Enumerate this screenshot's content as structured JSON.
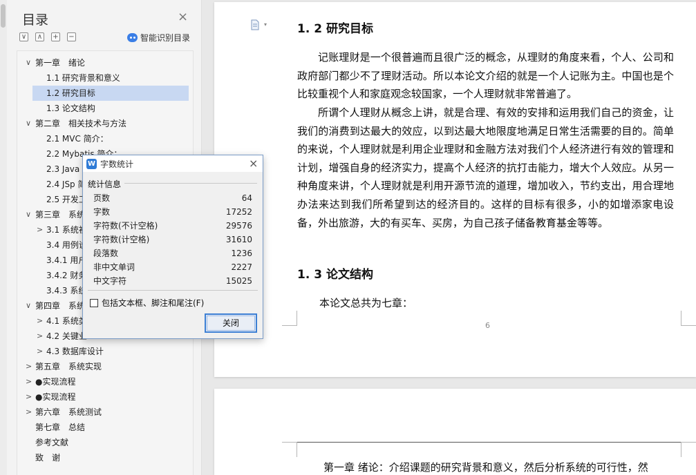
{
  "sidebar": {
    "title": "目录",
    "close_icon": "×",
    "tools": [
      "∨",
      "∧",
      "+",
      "−"
    ],
    "smart_label": "智能识别目录",
    "items": [
      {
        "label": "第一章　绪论",
        "level": 0,
        "arrow": "∨"
      },
      {
        "label": "1.1 研究背景和意义",
        "level": 1,
        "arrow": ""
      },
      {
        "label": "1.2 研究目标",
        "level": 1,
        "arrow": "",
        "selected": true
      },
      {
        "label": "1.3 论文结构",
        "level": 1,
        "arrow": ""
      },
      {
        "label": "第二章　相关技术与方法",
        "level": 0,
        "arrow": "∨"
      },
      {
        "label": "2.1 MVC 简介：",
        "level": 1,
        "arrow": ""
      },
      {
        "label": "2.2 Mybatis 简介：",
        "level": 1,
        "arrow": ""
      },
      {
        "label": "2.3 Java 简",
        "level": 1,
        "arrow": ""
      },
      {
        "label": "2.4 JSp 简",
        "level": 1,
        "arrow": ""
      },
      {
        "label": "2.5 开发工",
        "level": 1,
        "arrow": ""
      },
      {
        "label": "第三章　系统",
        "level": 0,
        "arrow": "∨"
      },
      {
        "label": "3.1 系统初",
        "level": 1,
        "arrow": ">"
      },
      {
        "label": "3.4 用例说",
        "level": 1,
        "arrow": ""
      },
      {
        "label": "3.4.1 用户",
        "level": 1,
        "arrow": ""
      },
      {
        "label": "3.4.2 财务",
        "level": 1,
        "arrow": ""
      },
      {
        "label": "3.4.3 系统",
        "level": 1,
        "arrow": ""
      },
      {
        "label": "第四章　系统",
        "level": 0,
        "arrow": "∨"
      },
      {
        "label": "4.1 系统类",
        "level": 1,
        "arrow": ">"
      },
      {
        "label": "4.2 关键业",
        "level": 1,
        "arrow": ">"
      },
      {
        "label": "4.3 数据库设计",
        "level": 1,
        "arrow": ">"
      },
      {
        "label": "第五章　系统实现",
        "level": 0,
        "arrow": ">"
      },
      {
        "label": "●实现流程",
        "level": 0,
        "arrow": ">"
      },
      {
        "label": "●实现流程",
        "level": 0,
        "arrow": ">"
      },
      {
        "label": "第六章　系统测试",
        "level": 0,
        "arrow": ">"
      },
      {
        "label": "第七章　总结",
        "level": 0,
        "arrow": ""
      },
      {
        "label": "参考文献",
        "level": 0,
        "arrow": ""
      },
      {
        "label": "致　谢",
        "level": 0,
        "arrow": ""
      }
    ]
  },
  "document": {
    "h_1_2": "1. 2 研究目标",
    "p1": "记账理财是一个很普遍而且很广泛的概念，从理财的角度来看，个人、公司和政府部门都少不了理财活动。所以本论文介绍的就是一个人记账为主。中国也是个比较重视个人和家庭观念较国家，一个人理财就非常普遍了。",
    "p2": "所谓个人理财从概念上讲，就是合理、有效的安排和运用我们自己的资金，让我们的消费到达最大的效应，以到达最大地限度地满足日常生活需要的目的。简单的来说，个人理财就是利用企业理财和金融方法对我们个人经济进行有效的管理和计划，增强自身的经济实力，提高个人经济的抗打击能力，增大个人效应。从另一种角度来讲，个人理财就是利用开源节流的道理，增加收入，节约支出，用合理地办法来达到我们所希望到达的经济目的。这样的目标有很多，小的如增添家电设备，外出旅游，大的有买车、买房，为自己孩子储备教育基金等等。",
    "h_1_3": "1. 3 论文结构",
    "p3": "本论文总共为七章：",
    "page_number": "6",
    "p4": "第一章 绪论：介绍课题的研究背景和意义，然后分析系统的可行性，然"
  },
  "dialog": {
    "icon": "W",
    "title": "字数统计",
    "close": "×",
    "group_label": "统计信息",
    "stats": [
      {
        "label": "页数",
        "value": "64"
      },
      {
        "label": "字数",
        "value": "17252"
      },
      {
        "label": "字符数(不计空格)",
        "value": "29576"
      },
      {
        "label": "字符数(计空格)",
        "value": "31610"
      },
      {
        "label": "段落数",
        "value": "1236"
      },
      {
        "label": "非中文单词",
        "value": "2227"
      },
      {
        "label": "中文字符",
        "value": "15025"
      }
    ],
    "checkbox_label": "包括文本框、脚注和尾注(F)",
    "checkbox_checked": false,
    "close_button": "关闭"
  }
}
